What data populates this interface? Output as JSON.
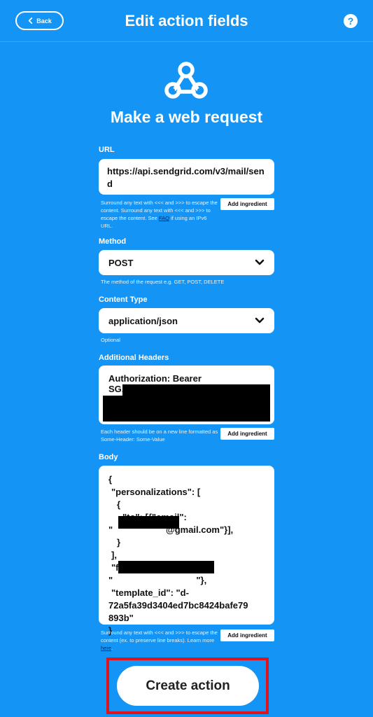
{
  "header": {
    "back_label": "Back",
    "title": "Edit action fields",
    "help_label": "?"
  },
  "service": {
    "icon": "webhooks-icon",
    "action_title": "Make a web request"
  },
  "fields": {
    "url": {
      "label": "URL",
      "value": "https://api.sendgrid.com/v3/mail/send",
      "helper_1": "Surround any text with <<< and >>> to escape the content. Surround any text with <<< and >>> to escape the content. See ",
      "helper_link": "FAQ",
      "helper_2": " if using an IPv6 URL.",
      "ingredient_label": "Add ingredient"
    },
    "method": {
      "label": "Method",
      "value": "POST",
      "helper": "The method of the request e.g. GET, POST, DELETE"
    },
    "content_type": {
      "label": "Content Type",
      "value": "application/json",
      "helper": "Optional"
    },
    "headers": {
      "label": "Additional Headers",
      "line_1": "Authorization: Bearer",
      "line_2": "SG.",
      "helper": "Each header should be on a new line formatted as Some-Header: Some-Value",
      "ingredient_label": "Add ingredient"
    },
    "body": {
      "label": "Body",
      "line_1": "{",
      "line_2": "  \"personalizations\": [",
      "line_3": "    {",
      "line_4": "      \"to\": [{\"email\":",
      "line_5": "\"                     @gmail.com\"}],",
      "line_6": "    }",
      "line_7": "  ],",
      "line_8": "  \"from\": {\"email\":",
      "line_9": "\"                                 \"},",
      "line_10": "  \"template_id\": \"d-",
      "line_11": "72a5fa39d3404ed7bc8424bafe79",
      "line_12": "893b\"",
      "line_13": "}",
      "helper_1": "Surround any text with <<< and >>> to escape the content (ex. to preserve line breaks). Learn more ",
      "helper_link": "here",
      "helper_2": ".",
      "ingredient_label": "Add ingredient"
    }
  },
  "footer": {
    "create_label": "Create action",
    "highlight_color": "#e0141e"
  },
  "colors": {
    "background": "#1495f5",
    "field_bg": "#ffffff"
  }
}
